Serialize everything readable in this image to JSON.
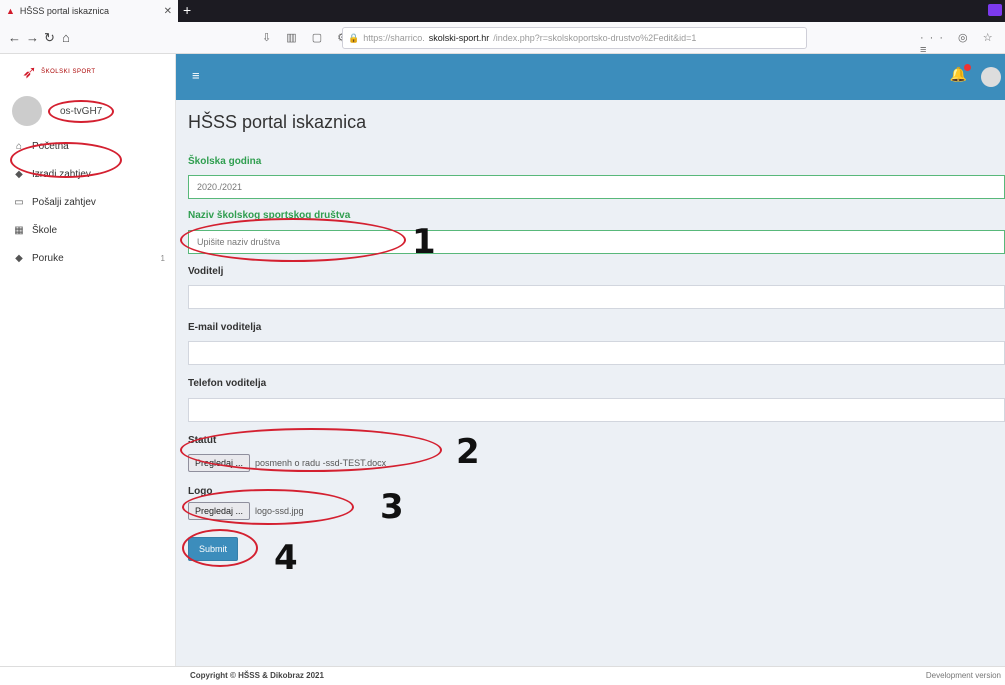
{
  "browser": {
    "tab_title": "HŠSS portal iskaznica",
    "url_prefix": "https://sharrico.",
    "url_domain": "skolski-sport.hr",
    "url_rest": "/index.php?r=skolskoportsko-drustvo%2Fedit&id=1"
  },
  "sidebar": {
    "brand": "ŠKOLSKI SPORT",
    "username": "os-tvGH7",
    "items": [
      {
        "label": "Početna",
        "icon": "home-icon"
      },
      {
        "label": "Izradi zahtjev",
        "icon": "tag-icon"
      },
      {
        "label": "Pošalji zahtjev",
        "icon": "document-icon"
      },
      {
        "label": "Škole",
        "icon": "building-icon"
      },
      {
        "label": "Poruke",
        "icon": "tag-icon",
        "badge": "1"
      }
    ]
  },
  "main": {
    "title": "HŠSS portal iskaznica",
    "fields": [
      {
        "label": "Školska godina",
        "value": "2020./2021"
      },
      {
        "label": "Naziv školskog sportskog društva",
        "placeholder": "Upišite naziv društva"
      },
      {
        "label": "Voditelj",
        "value": ""
      },
      {
        "label": "E-mail voditelja",
        "value": ""
      },
      {
        "label": "Telefon voditelja",
        "value": ""
      }
    ],
    "statut": {
      "label": "Statut",
      "button": "Pregledaj ...",
      "filename": "posmenh o radu -ssd-TEST.docx"
    },
    "logo": {
      "label": "Logo",
      "button": "Pregledaj ...",
      "filename": "logo-ssd.jpg"
    },
    "submit_label": "Submit"
  },
  "annotations": [
    "1",
    "2",
    "3",
    "4"
  ],
  "footer": {
    "copyright": "Copyright © HŠSS & Dikobraz 2021",
    "version": "Development version"
  },
  "colors": {
    "primary": "#3c8dbc",
    "valid": "#2f9e4f",
    "annotation": "#d42030"
  }
}
